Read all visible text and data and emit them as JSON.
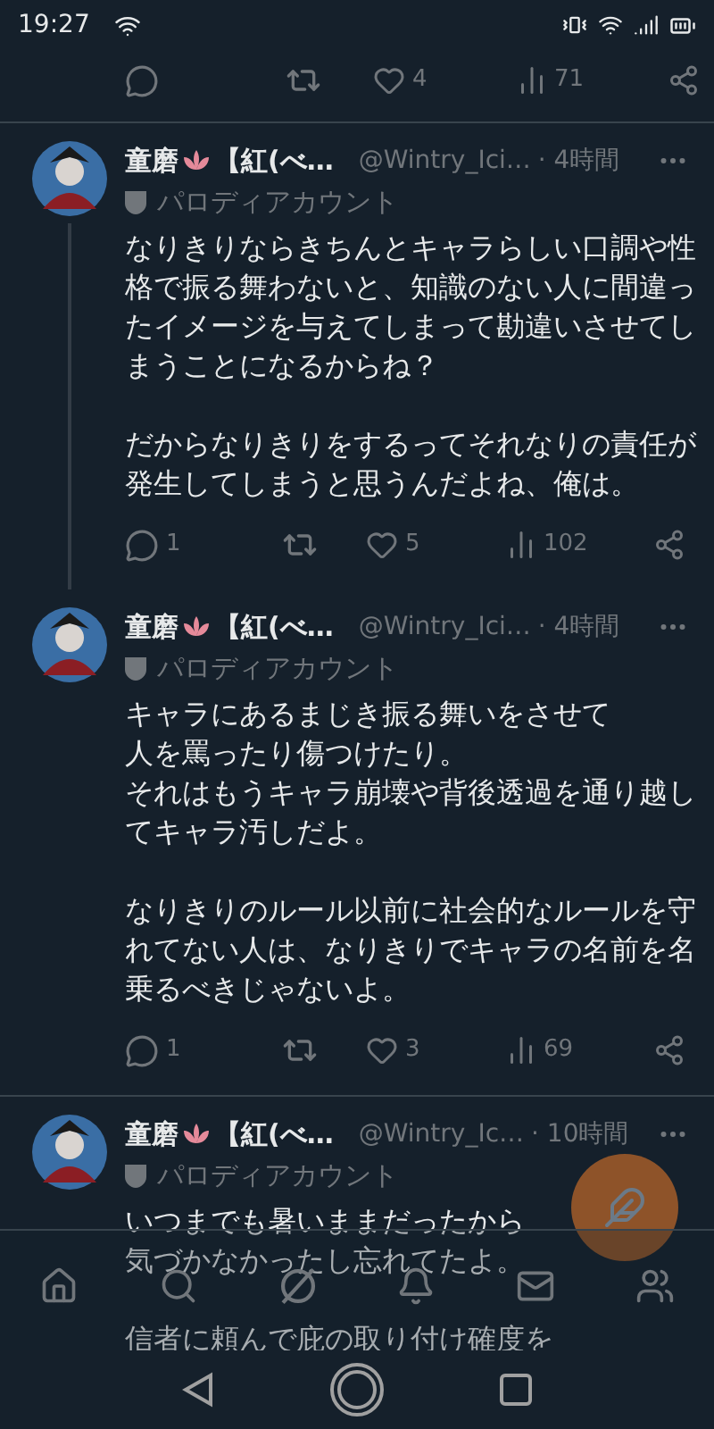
{
  "status_bar": {
    "time": "19:27"
  },
  "previous_actions": {
    "likes": "4",
    "views": "71"
  },
  "tweets": [
    {
      "name": "童磨",
      "name_suffix": "【紅(べ…",
      "handle": "@Wintry_Ici…",
      "time": "· 4時間",
      "label": "パロディアカウント",
      "thread_below": true,
      "paragraphs": [
        [
          "なりきりならきちんとキャラらしい口調や性格で振る舞わないと、知識のない人に間違ったイメージを与えてしまって勘違いさせてしまうことになるからね？"
        ],
        [
          "だからなりきりをするってそれなりの責任が発生してしまうと思うんだよね、俺は。"
        ]
      ],
      "actions": {
        "replies": "1",
        "likes": "5",
        "views": "102"
      }
    },
    {
      "name": "童磨",
      "name_suffix": "【紅(べ…",
      "handle": "@Wintry_Ici…",
      "time": "· 4時間",
      "label": "パロディアカウント",
      "thread_below": false,
      "paragraphs": [
        [
          "キャラにあるまじき振る舞いをさせて",
          "人を罵ったり傷つけたり。",
          "それはもうキャラ崩壊や背後透過を通り越してキャラ汚しだよ。"
        ],
        [
          "なりきりのルール以前に社会的なルールを守れてない人は、なりきりでキャラの名前を名乗るべきじゃないよ。"
        ]
      ],
      "actions": {
        "replies": "1",
        "likes": "3",
        "views": "69"
      }
    },
    {
      "name": "童磨",
      "name_suffix": "【紅(べ…",
      "handle": "@Wintry_Ic…",
      "time": "· 10時間",
      "label": "パロディアカウント",
      "thread_below": false,
      "paragraphs": [
        [
          "いつまでも暑いままだったから",
          "気づかなかったし忘れてたよ。"
        ],
        [
          "信者に頼んで庇の取り付け確度を"
        ]
      ]
    }
  ]
}
